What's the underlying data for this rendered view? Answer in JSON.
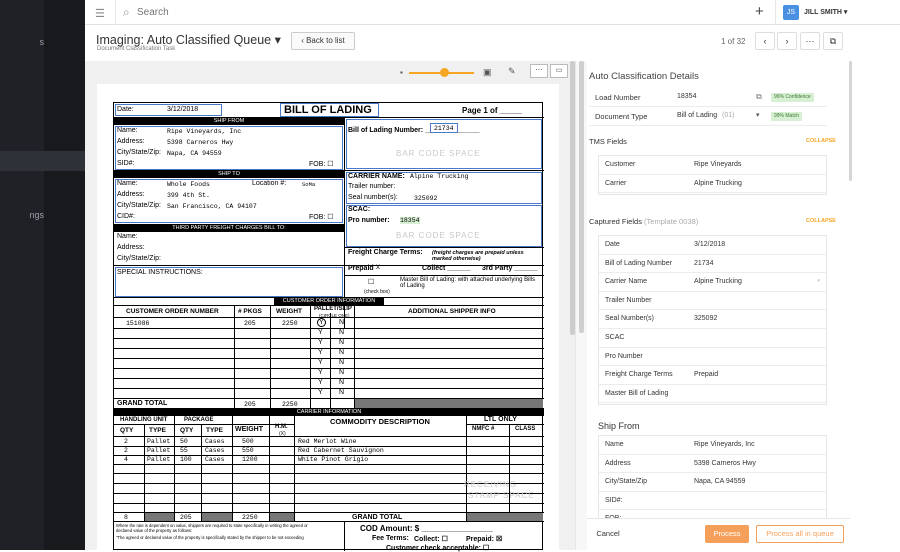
{
  "sidebar": {
    "item1": "s",
    "item2": "ngs"
  },
  "topbar": {
    "search_placeholder": "Search",
    "add": "+",
    "avatar": "JS",
    "user": "JILL SMITH ▾"
  },
  "header": {
    "title": "Imaging: Auto Classified Queue ▾",
    "subtitle": "Document Classification Task",
    "back": "Back to list",
    "pager": "1 of 32",
    "prev": "‹",
    "next": "›",
    "more": "···",
    "open": "⧉"
  },
  "document": {
    "date_label": "Date:",
    "date": "3/12/2018",
    "title": "BILL OF LADING",
    "page": "Page 1 of _____",
    "ship_from_bar": "SHIP FROM",
    "name_l": "Name:",
    "addr_l": "Address:",
    "csz_l": "City/State/Zip:",
    "sid_l": "SID#:",
    "fob": "FOB: ☐",
    "from_name": "Ripe Vineyards, Inc",
    "from_addr": "5398 Carneros Hwy",
    "from_csz": "Napa, CA 94559",
    "bol_num_l": "Bill of Lading Number: ______________",
    "bol_num": "21734",
    "barcode": "BAR CODE SPACE",
    "ship_to_bar": "SHIP TO",
    "location_l": "Location #:",
    "location": "SoMa",
    "to_name": "Whole Foods",
    "to_addr": "399 4th St.",
    "to_csz": "San Francisco, CA 94107",
    "cid_l": "CID#:",
    "carrier_l": "CARRIER NAME:",
    "carrier": "Alpine Trucking",
    "trailer_l": "Trailer number:",
    "seal_l": "Seal number(s):",
    "seal": "325092",
    "scac_l": "SCAC:",
    "pro_l": "Pro number:",
    "pro": "18354",
    "third_bar": "THIRD PARTY FREIGHT CHARGES BILL TO:",
    "special": "SPECIAL INSTRUCTIONS:",
    "freight_terms": "Freight Charge Terms:",
    "freight_note": "(freight charges are prepaid unless marked otherwise)",
    "prepaid_l": "Prepaid",
    "prepaid": "X",
    "collect_l": "Collect ______",
    "third_party": "3rd Party ______",
    "master_l": "Master Bill of Lading: with attached underlying Bills of Lading",
    "checkbox": "(check box)",
    "cust_bar": "CUSTOMER ORDER INFORMATION",
    "col_order": "CUSTOMER ORDER NUMBER",
    "col_pkgs": "# PKGS",
    "col_weight": "WEIGHT",
    "col_pallet": "PALLET/SLIP",
    "col_circle": "(CIRCLE ONE)",
    "col_addl": "ADDITIONAL SHIPPER INFO",
    "order_num": "151086",
    "order_pkgs": "205",
    "order_wt": "2250",
    "y": "Y",
    "n": "N",
    "grand_total": "GRAND TOTAL",
    "gt_pkgs": "205",
    "gt_wt": "2250",
    "carrier_bar": "CARRIER INFORMATION",
    "hu": "HANDLING UNIT",
    "pkg": "PACKAGE",
    "qty": "QTY",
    "type": "TYPE",
    "weight": "WEIGHT",
    "hm": "H.M.",
    "hmx": "(X)",
    "commodity": "COMMODITY DESCRIPTION",
    "ltl": "LTL ONLY",
    "nmfc": "NMFC #",
    "class": "CLASS",
    "items": [
      {
        "hq": "2",
        "ht": "Pallet",
        "pq": "50",
        "pt": "Cases",
        "w": "500",
        "d": "Red Merlot Wine"
      },
      {
        "hq": "2",
        "ht": "Pallet",
        "pq": "55",
        "pt": "Cases",
        "w": "550",
        "d": "Red Cabernet Sauvignon"
      },
      {
        "hq": "4",
        "ht": "Pallet",
        "pq": "100",
        "pt": "Cases",
        "w": "1200",
        "d": "White Pinot Grigio"
      }
    ],
    "receiving": "RECEIVING",
    "stamp": "STAMP SPACE",
    "tot_hq": "8",
    "tot_pq": "205",
    "tot_w": "2250",
    "note1": "Where the rate is dependent on value, shippers are required to state specifically in writing the agreed or",
    "note2": "declared value of the property as follows:",
    "note3": "\"The agreed or declared value of the property is specifically stated by the shipper to be not exceeding",
    "cod": "COD Amount: $ ________________",
    "fee": "Fee Terms:",
    "collect2": "Collect: ☐",
    "prepaid2": "Prepaid: ☒",
    "customer_check": "Customer check acceptable: ☐"
  },
  "panel": {
    "title": "Auto Classification Details",
    "load_l": "Load Number",
    "load": "18354",
    "load_conf": "96% Confidence",
    "doctype_l": "Document Type",
    "doctype": "Bill of Lading",
    "doctype_n": "(01)",
    "doctype_conf": "99% Match",
    "tms": "TMS Fields",
    "collapse": "COLLAPSE",
    "tms_rows": [
      {
        "l": "Customer",
        "v": "Ripe Vineyards"
      },
      {
        "l": "Carrier",
        "v": "Alpine Trucking"
      }
    ],
    "captured": "Captured Fields",
    "template": "(Template 0038)",
    "captured_rows": [
      {
        "l": "Date",
        "v": "3/12/2018"
      },
      {
        "l": "Bill of Lading Number",
        "v": "21734"
      },
      {
        "l": "Carrier Name",
        "v": "Alpine Trucking"
      },
      {
        "l": "Trailer Number",
        "v": ""
      },
      {
        "l": "Seal Number(s)",
        "v": "325092"
      },
      {
        "l": "SCAC",
        "v": ""
      },
      {
        "l": "Pro Number",
        "v": ""
      },
      {
        "l": "Freight Charge Terms",
        "v": "Prepaid"
      },
      {
        "l": "Master Bill of Lading",
        "v": ""
      }
    ],
    "ship_from": "Ship From",
    "ship_rows": [
      {
        "l": "Name",
        "v": "Ripe Vineyards, Inc"
      },
      {
        "l": "Address",
        "v": "5398 Carneros Hwy"
      },
      {
        "l": "City/State/Zip",
        "v": "Napa, CA 94559"
      },
      {
        "l": "SID#:",
        "v": ""
      },
      {
        "l": "FOB:",
        "v": ""
      }
    ]
  },
  "footer": {
    "cancel": "Cancel",
    "process": "Process",
    "process_all": "Process all in queue"
  },
  "colors": {
    "accent": "#f5a623",
    "sidebar": "#1f2126",
    "confidence_bg": "#d7efd2",
    "avatar": "#4a90e2"
  }
}
